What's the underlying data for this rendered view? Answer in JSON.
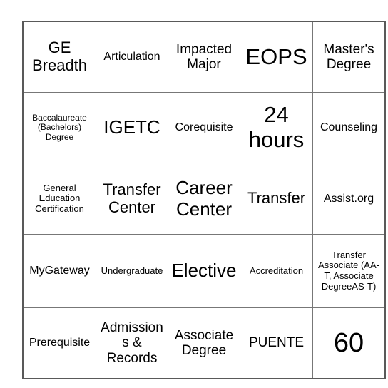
{
  "card": {
    "type": "bingo-card",
    "columns": 5,
    "rows": 5,
    "border_color": "#595959",
    "grid_line_color": "#777777",
    "background_color": "#ffffff",
    "text_color": "#000000",
    "cells": [
      [
        {
          "text": "GE Breadth",
          "size": "xl"
        },
        {
          "text": "Articulation",
          "size": "md"
        },
        {
          "text": "Impacted Major",
          "size": "lg"
        },
        {
          "text": "EOPS",
          "size": "huge"
        },
        {
          "text": "Master's Degree",
          "size": "lg"
        }
      ],
      [
        {
          "text": "Baccalaureate (Bachelors) Degree",
          "size": "xs"
        },
        {
          "text": "IGETC",
          "size": "xxl"
        },
        {
          "text": "Corequisite",
          "size": "md"
        },
        {
          "text": "24 hours",
          "size": "huge"
        },
        {
          "text": "Counseling",
          "size": "md"
        }
      ],
      [
        {
          "text": "General Education Certification",
          "size": "sm"
        },
        {
          "text": "Transfer Center",
          "size": "xl"
        },
        {
          "text": "Career Center",
          "size": "xxl"
        },
        {
          "text": "Transfer",
          "size": "xl"
        },
        {
          "text": "Assist.org",
          "size": "md"
        }
      ],
      [
        {
          "text": "MyGateway",
          "size": "md"
        },
        {
          "text": "Undergraduate",
          "size": "sm"
        },
        {
          "text": "Elective",
          "size": "xxl"
        },
        {
          "text": "Accreditation",
          "size": "sm"
        },
        {
          "text": "Transfer Associate (AA-T, Associate DegreeAS-T)",
          "size": "sm"
        }
      ],
      [
        {
          "text": "Prerequisite",
          "size": "md"
        },
        {
          "text": "Admissions & Records",
          "size": "lg"
        },
        {
          "text": "Associate Degree",
          "size": "lg"
        },
        {
          "text": "PUENTE",
          "size": "lg"
        },
        {
          "text": "60",
          "size": "mega"
        }
      ]
    ]
  }
}
